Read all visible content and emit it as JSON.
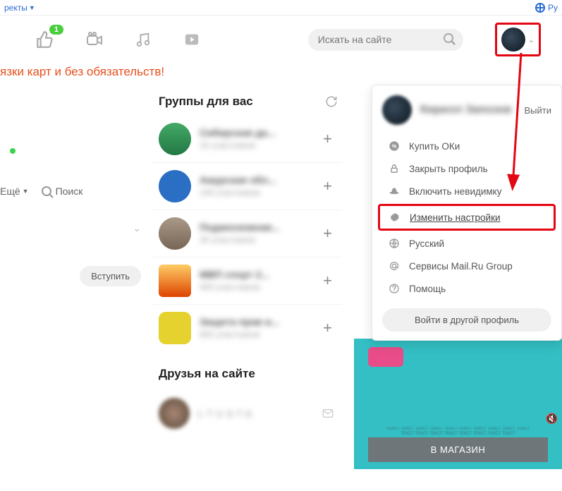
{
  "topbar": {
    "left": "ректы",
    "right": "Ру"
  },
  "header": {
    "badge": "1",
    "search_placeholder": "Искать на сайте"
  },
  "promo": "язки карт и без обязательств!",
  "left": {
    "more": "Ещё",
    "search": "Поиск",
    "join": "Вступить"
  },
  "groups": {
    "title": "Группы для вас",
    "items": [
      {
        "title": "Сибирская да...",
        "sub": "1К участников"
      },
      {
        "title": "Амурская обл...",
        "sub": "10К участников"
      },
      {
        "title": "Подмосковная...",
        "sub": "2К участников"
      },
      {
        "title": "МВП спорт 2...",
        "sub": "400 участников"
      },
      {
        "title": "Защита прав и...",
        "sub": "800 участников"
      }
    ]
  },
  "friends": {
    "title": "Друзья на сайте",
    "name": "L T U S T A"
  },
  "dropdown": {
    "name": "Кирилл Запозов",
    "logout": "Выйти",
    "buy": "Купить ОКи",
    "lock": "Закрыть профиль",
    "invisible": "Включить невидимку",
    "settings": "Изменить настройки",
    "lang": "Русский",
    "services": "Сервисы Mail.Ru Group",
    "help": "Помощь",
    "switch": "Войти в другой профиль"
  },
  "ad": {
    "button": "В МАГАЗИН"
  }
}
